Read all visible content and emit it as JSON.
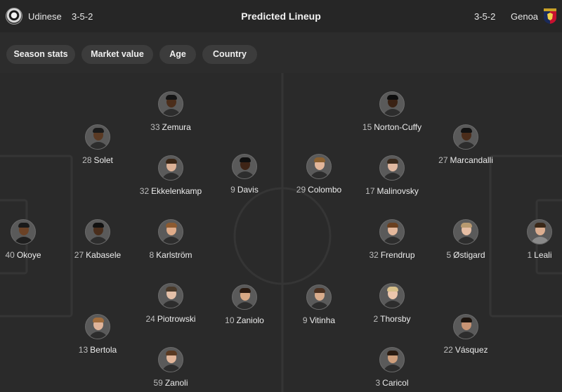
{
  "header": {
    "title": "Predicted Lineup",
    "home": {
      "name": "Udinese",
      "formation": "3-5-2",
      "logo_icon": "udinese-crest-icon"
    },
    "away": {
      "name": "Genoa",
      "formation": "3-5-2",
      "logo_icon": "genoa-crest-icon"
    }
  },
  "filters": [
    "Season stats",
    "Market value",
    "Age",
    "Country"
  ],
  "home_players": [
    {
      "number": "40",
      "name": "Okoye"
    },
    {
      "number": "27",
      "name": "Kabasele"
    },
    {
      "number": "28",
      "name": "Solet"
    },
    {
      "number": "13",
      "name": "Bertola"
    },
    {
      "number": "33",
      "name": "Zemura"
    },
    {
      "number": "32",
      "name": "Ekkelenkamp"
    },
    {
      "number": "8",
      "name": "Karlström"
    },
    {
      "number": "24",
      "name": "Piotrowski"
    },
    {
      "number": "59",
      "name": "Zanoli"
    },
    {
      "number": "9",
      "name": "Davis"
    },
    {
      "number": "10",
      "name": "Zaniolo"
    }
  ],
  "away_players": [
    {
      "number": "15",
      "name": "Norton-Cuffy"
    },
    {
      "number": "29",
      "name": "Colombo"
    },
    {
      "number": "17",
      "name": "Malinovsky"
    },
    {
      "number": "32",
      "name": "Frendrup"
    },
    {
      "number": "9",
      "name": "Vitinha"
    },
    {
      "number": "2",
      "name": "Thorsby"
    },
    {
      "number": "3",
      "name": "Caricol"
    },
    {
      "number": "27",
      "name": "Marcandalli"
    },
    {
      "number": "5",
      "name": "Østigard"
    },
    {
      "number": "22",
      "name": "Vásquez"
    },
    {
      "number": "1",
      "name": "Leali"
    }
  ]
}
